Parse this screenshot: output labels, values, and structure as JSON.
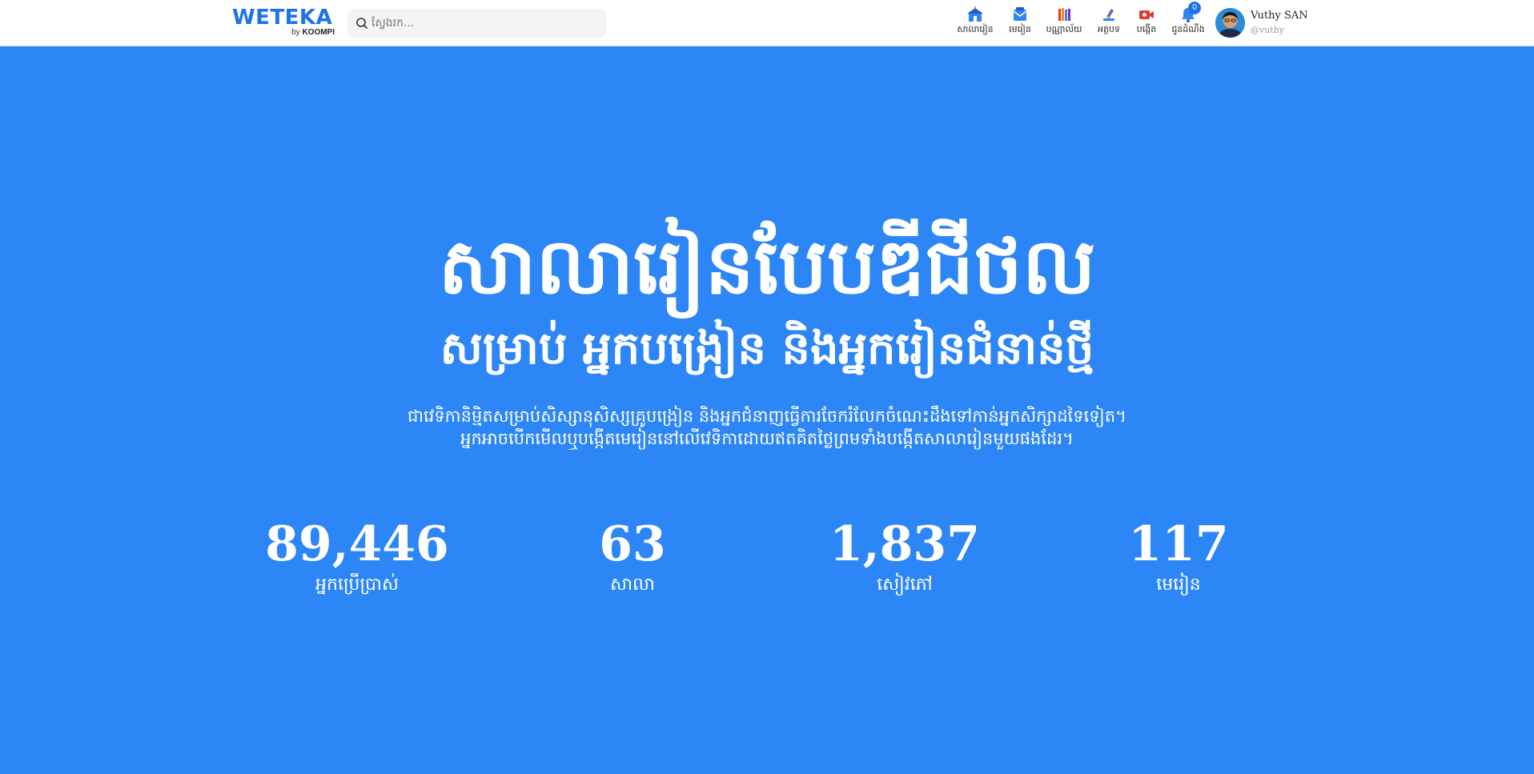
{
  "header": {
    "logo": {
      "wordmark": "WETEKA",
      "by": "by",
      "brand": "KOOMPI"
    },
    "search": {
      "placeholder": "ស្វែងរក...",
      "value": ""
    },
    "nav": [
      {
        "label": "សាលារៀន",
        "icon": "school-icon"
      },
      {
        "label": "មេរៀន",
        "icon": "lesson-icon"
      },
      {
        "label": "បណ្ណាល័យ",
        "icon": "library-icon"
      },
      {
        "label": "អត្ថបទ",
        "icon": "article-icon"
      },
      {
        "label": "បង្កើត",
        "icon": "create-video-icon"
      },
      {
        "label": "ជូនដំណឹង",
        "icon": "bell-icon",
        "badge": "0"
      }
    ],
    "user": {
      "name": "Vuthy SAN",
      "handle": "@vuthy"
    }
  },
  "hero": {
    "title": "សាលារៀនបែបឌីជីថល",
    "subtitle": "សម្រាប់ អ្នកបង្រៀន និងអ្នករៀនជំនាន់ថ្មី",
    "description_line1": "ជាវេទិកានិម្មិតសម្រាប់សិស្សានុសិស្សគ្រូបង្រៀន និងអ្នកជំនាញធ្វើការចែករំលែកចំណេះដឹងទៅកាន់អ្នកសិក្សាដទៃទៀត។",
    "description_line2": "អ្នកអាចបើកមើលឬបង្កើតមេរៀននៅលើវេទិកាដោយឥតគិតថ្លៃព្រមទាំងបង្កើតសាលារៀនមួយផងដែរ។"
  },
  "stats": [
    {
      "value": "89,446",
      "label": "អ្នកប្រើប្រាស់"
    },
    {
      "value": "63",
      "label": "សាលា"
    },
    {
      "value": "1,837",
      "label": "សៀវភៅ"
    },
    {
      "value": "117",
      "label": "មេរៀន"
    }
  ],
  "colors": {
    "brand": "#1d74ea",
    "hero_background": "#2d86f5",
    "text_on_hero": "#ffffff"
  }
}
